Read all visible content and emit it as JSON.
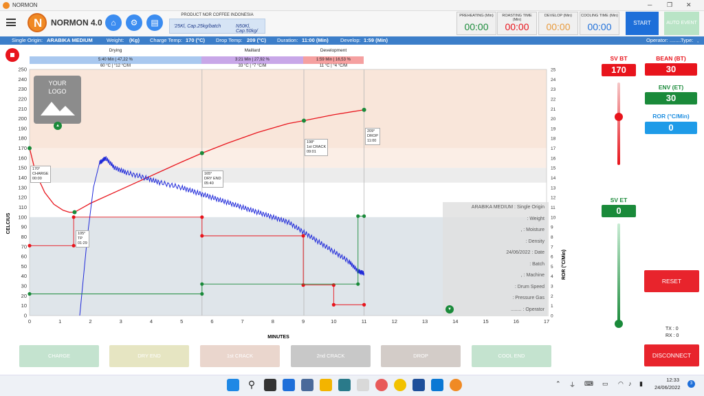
{
  "window": {
    "title": "NORMON"
  },
  "header": {
    "brand": "NORMON 4.0",
    "product_title": "PRODUCT NOR COFFEE INDONESIA",
    "product_line1": "'25Kl, Cap.25kg/batch",
    "product_line2": "N50Kl, Cap.50kg/",
    "timers": [
      {
        "label": "PREHEATING (Min)",
        "value": "00:00",
        "color": "#1a8a3a"
      },
      {
        "label": "ROASTING TIME (Min)",
        "value": "00:00",
        "color": "#e8141c"
      },
      {
        "label": "DEVELOP (Min)",
        "value": "00:00",
        "color": "#e89a3c"
      },
      {
        "label": "COOLING TIME (Min)",
        "value": "00:00",
        "color": "#1e6fd9"
      }
    ],
    "start": "START",
    "auto_event": "AUTO EVENT"
  },
  "infobar": {
    "origin_label": "Single Origin:",
    "origin": "ARABIKA MEDIUM",
    "weight_label": "Weight:",
    "weight": "(Kg)",
    "charge_label": "Charge Temp:",
    "charge": "170 (°C)",
    "drop_label": "Drop Temp:",
    "drop": "209 (°C)",
    "duration_label": "Duration:",
    "duration": "11:00 (Min)",
    "develop_label": "Develop:",
    "develop": "1:59 (Min)",
    "operator_label": "Operator:",
    "operator": "........",
    "type_label": "Type:",
    "type": ","
  },
  "phases": [
    {
      "name": "Drying",
      "bar": "5:40 Min | 47,22 %",
      "sub": "60 °C | °12 °C/M",
      "color": "#a9c8ef"
    },
    {
      "name": "Maillard",
      "bar": "3:21 Min | 27,92 %",
      "sub": "33 °C | °7 °C/M",
      "color": "#c8a7e8"
    },
    {
      "name": "Development",
      "bar": "1:59 Min | 16,53 %",
      "sub": "11 °C | °4 °C/M",
      "color": "#f5a0a0"
    }
  ],
  "chart_labels": {
    "ylabel": "CELCIUS",
    "xlabel": "MINUTES",
    "y2label": "ROR (°C/Min)",
    "logo_line1": "YOUR",
    "logo_line2": "LOGO"
  },
  "annotations": [
    {
      "temp": "170°",
      "name": "CHARGE",
      "time": "00:00"
    },
    {
      "temp": "105°",
      "name": "TP",
      "time": "01:29"
    },
    {
      "temp": "165°",
      "name": "DRY END",
      "time": "05:40"
    },
    {
      "temp": "198°",
      "name": "1st CRACK",
      "time": "09:01"
    },
    {
      "temp": "209°",
      "name": "DROP",
      "time": "11:00"
    }
  ],
  "info_panel": [
    "ARABIKA MEDIUM  : Single Origin",
    ": Weight",
    ",  : Moisture",
    ": Density",
    "24/06/2022 : Date",
    ": Batch",
    ",  : Machine",
    ": Drum Speed",
    ": Pressure Gas",
    "........ : Operator"
  ],
  "side": {
    "sv_bt_label": "SV BT",
    "sv_bt": "170",
    "bean_label": "BEAN (BT)",
    "bean": "30",
    "env_label": "ENV (ET)",
    "env": "30",
    "ror_label": "ROR (°C/Min)",
    "ror": "0",
    "sv_et_label": "SV ET",
    "sv_et": "0",
    "reset": "RESET",
    "tx": "TX : 0",
    "rx": "RX : 0",
    "disconnect": "DISCONNECT"
  },
  "events": [
    {
      "label": "CHARGE",
      "color": "#c4e3cf"
    },
    {
      "label": "DRY END",
      "color": "#e6e5c2"
    },
    {
      "label": "1st CRACK",
      "color": "#ead6cd"
    },
    {
      "label": "2nd CRACK",
      "color": "#c8c8c8"
    },
    {
      "label": "DROP",
      "color": "#d3ccc8"
    },
    {
      "label": "COOL END",
      "color": "#c4e3cf"
    }
  ],
  "taskbar": {
    "time": "12:33",
    "date": "24/06/2022",
    "badge": "3"
  },
  "chart_data": {
    "type": "line",
    "xlabel": "MINUTES",
    "ylabel": "CELCIUS",
    "y2label": "ROR (°C/Min)",
    "xlim": [
      0,
      17
    ],
    "ylim": [
      0,
      250
    ],
    "y2lim": [
      0,
      25
    ],
    "xticks": [
      0,
      1,
      2,
      3,
      4,
      5,
      6,
      7,
      8,
      9,
      10,
      11,
      12,
      13,
      14,
      15,
      16,
      17
    ],
    "yticks": [
      0,
      10,
      20,
      30,
      40,
      50,
      60,
      70,
      80,
      90,
      100,
      110,
      120,
      130,
      140,
      150,
      160,
      170,
      180,
      190,
      200,
      210,
      220,
      230,
      240,
      250
    ],
    "y2ticks": [
      0,
      1,
      2,
      3,
      4,
      5,
      6,
      7,
      8,
      9,
      10,
      11,
      12,
      13,
      14,
      15,
      16,
      17,
      18,
      19,
      20,
      21,
      22,
      23,
      24,
      25
    ],
    "series": [
      {
        "name": "BT",
        "color": "#e8141c",
        "x": [
          0,
          0.2,
          0.5,
          0.8,
          1.1,
          1.3,
          1.48,
          2,
          3,
          4,
          5,
          5.67,
          6.5,
          7.5,
          8.5,
          9.02,
          10,
          11
        ],
        "y": [
          170,
          145,
          125,
          113,
          107,
          105,
          105,
          114,
          128,
          142,
          156,
          165,
          175,
          186,
          195,
          198,
          204,
          209
        ]
      },
      {
        "name": "ROR",
        "color": "#1e28d9",
        "x": [
          1.65,
          1.9,
          2.1,
          2.3,
          2.5,
          2.8,
          3.2,
          3.8,
          4.3,
          5,
          5.5,
          6,
          6.5,
          7,
          7.5,
          8,
          8.5,
          9,
          9.5,
          10,
          10.5,
          10.8,
          11
        ],
        "y": [
          0,
          8,
          13,
          15.5,
          16,
          15,
          14.5,
          14,
          13.5,
          13,
          12.5,
          12,
          11.5,
          11,
          10.5,
          10,
          9.5,
          8.5,
          7.5,
          6.5,
          5.5,
          4.5,
          4.3
        ]
      },
      {
        "name": "Gas",
        "color": "#e8141c",
        "x": [
          0,
          1.45,
          1.45,
          5.67,
          5.67,
          9,
          9,
          10,
          10,
          11
        ],
        "y": [
          71,
          71,
          100,
          100,
          81,
          81,
          31,
          31,
          11,
          11
        ]
      },
      {
        "name": "Air",
        "color": "#1a8a3a",
        "x": [
          0,
          5.67,
          5.67,
          10.8,
          10.8,
          11
        ],
        "y": [
          22,
          22,
          32,
          32,
          101,
          101
        ]
      }
    ],
    "bands": [
      {
        "from": 170,
        "to": 250,
        "color": "#f9e6da"
      },
      {
        "from": 150,
        "to": 170,
        "color": "#fbeee6"
      },
      {
        "from": 135,
        "to": 150,
        "color": "#ececec"
      },
      {
        "from": 0,
        "to": 100,
        "color": "#dfe5ea"
      }
    ]
  }
}
